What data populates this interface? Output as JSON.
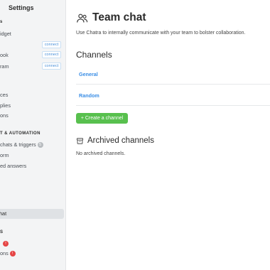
{
  "sidebar": {
    "title": "Settings",
    "items": [
      {
        "label": "s",
        "kind": "caption"
      },
      {
        "label": "idget",
        "kind": "item"
      },
      {
        "label": "connect",
        "kind": "connect"
      },
      {
        "label": "ook",
        "kind": "item",
        "connect": "connect"
      },
      {
        "label": "ram",
        "kind": "item",
        "connect": "connect"
      },
      {
        "label": "ces",
        "kind": "item"
      },
      {
        "label": "plies",
        "kind": "item"
      },
      {
        "label": "ons",
        "kind": "item"
      },
      {
        "label": "T & AUTOMATION",
        "kind": "caption"
      },
      {
        "label": "chats & triggers",
        "kind": "item",
        "badge": "5"
      },
      {
        "label": "orm",
        "kind": "item"
      },
      {
        "label": "ed answers",
        "kind": "item"
      },
      {
        "label": "hat",
        "kind": "active"
      },
      {
        "label": "S",
        "kind": "caption"
      },
      {
        "label": "",
        "kind": "item",
        "red_badge": "!"
      },
      {
        "label": "ons",
        "kind": "item",
        "red_badge": "!"
      }
    ]
  },
  "main": {
    "title": "Team chat",
    "title_icon": "team-users-icon",
    "description": "Use Chatra to internally communicate with your team to bolster collaboration.",
    "channels_heading": "Channels",
    "channels": [
      {
        "name": "General"
      },
      {
        "name": "Random"
      }
    ],
    "create_button": "+ Create a channel",
    "archived_heading": "Archived channels",
    "archived_icon": "archive-box-icon",
    "archived_empty": "No archived channels."
  },
  "colors": {
    "accent": "#3a8ee6",
    "create_button": "#58c04e",
    "badge_red": "#e54545",
    "sidebar_bg": "#f3f4f5"
  }
}
